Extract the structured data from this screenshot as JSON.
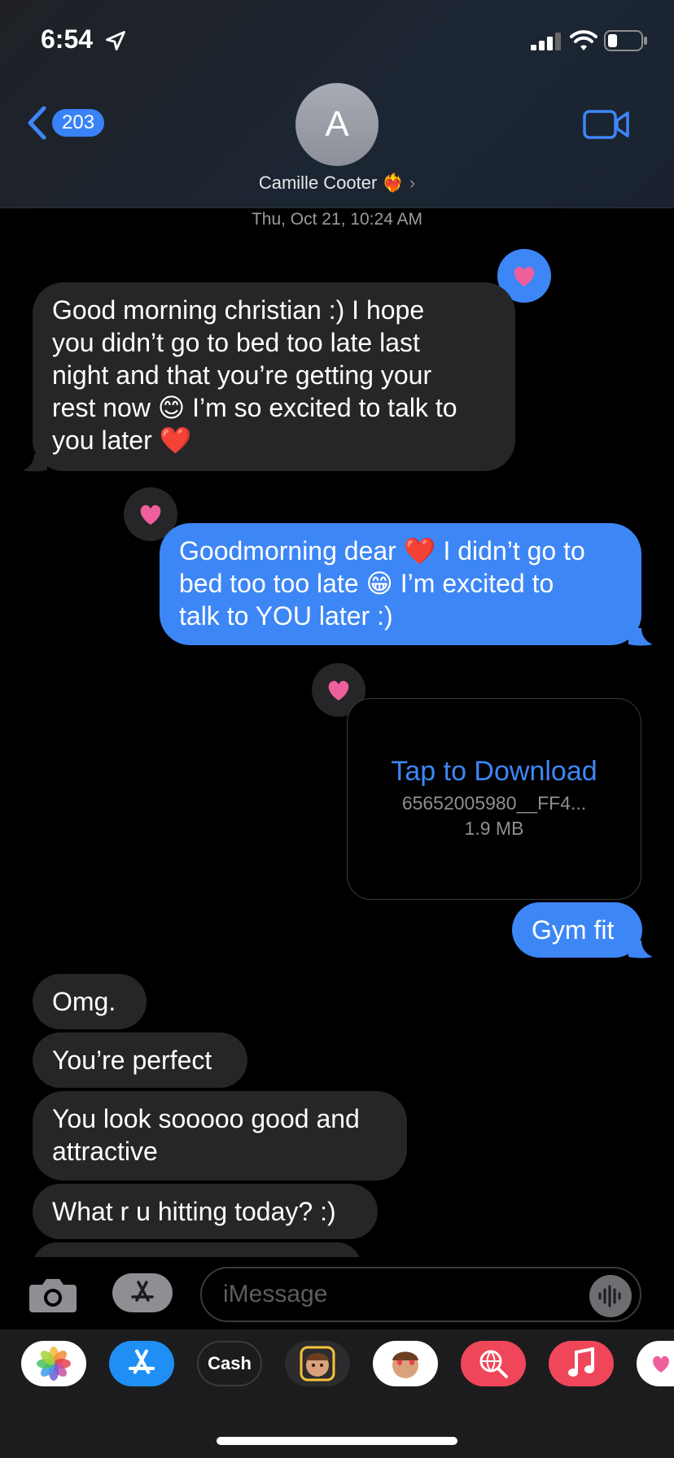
{
  "status": {
    "time": "6:54"
  },
  "header": {
    "back_count": "203",
    "avatar_initial": "A",
    "contact_name": "Camille Cooter ❤️‍🔥",
    "chevron": "›"
  },
  "timestamp": "Thu, Oct 21, 10:24 AM",
  "messages": [
    {
      "lines": [
        "Good morning christian :) I hope",
        "you didn’t go to bed too late last",
        "night and that you’re getting your",
        "rest now 😊 I’m so excited to talk to",
        "you later ❤️"
      ]
    },
    {
      "lines": [
        "Goodmorning dear ❤️ I didn’t go to",
        "bed too too late 😁 I’m excited to",
        "talk to YOU later :)"
      ]
    },
    {
      "text": "Gym fit"
    },
    {
      "text": "Omg."
    },
    {
      "text": "You’re perfect"
    },
    {
      "lines": [
        "You look sooooo good and",
        "attractive"
      ]
    },
    {
      "text": "What r u hitting today? :)"
    }
  ],
  "attachment": {
    "action": "Tap to Download",
    "filename": "65652005980__FF4...",
    "size": "1.9 MB"
  },
  "input": {
    "placeholder": "iMessage"
  },
  "apps": {
    "cash_label": "Cash"
  },
  "icons": {
    "location": "location-arrow-icon",
    "signal": "cellular-signal-icon",
    "wifi": "wifi-icon",
    "battery": "battery-icon",
    "back": "chevron-left-icon",
    "video": "video-camera-icon",
    "camera": "camera-icon",
    "app_store": "app-store-icon",
    "audio": "waveform-icon",
    "heart": "heart-icon"
  },
  "colors": {
    "accent": "#3d86f6",
    "incoming_bubble": "#262628",
    "heart": "#ef5f9d"
  }
}
